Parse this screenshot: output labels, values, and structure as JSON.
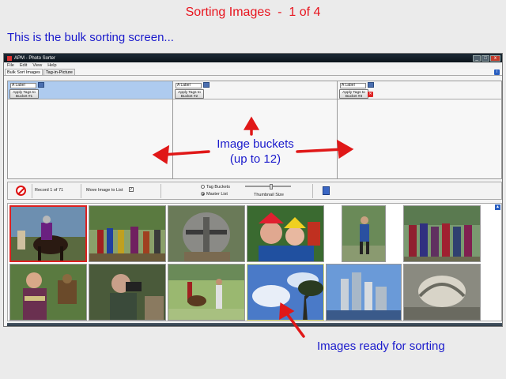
{
  "slide": {
    "title": "Sorting Images  -  1 of 4",
    "subtitle": "This is the bulk sorting screen...",
    "caption": "Images ready for sorting",
    "annotation_line1": "Image buckets",
    "annotation_line2": "(up to 12)"
  },
  "window": {
    "title": "APM - Photo Sorter",
    "min_glyph": "_",
    "max_glyph": "□",
    "close_glyph": "x"
  },
  "menu": [
    "File",
    "Edit",
    "View",
    "Help"
  ],
  "tabs": [
    "Bulk Sort Images",
    "Tag-in-Picture"
  ],
  "help_icon_glyph": "i",
  "buckets": [
    {
      "label_placeholder": "A Label",
      "apply_line1": "Apply Tags to",
      "apply_line2": "Bucket #1"
    },
    {
      "label_placeholder": "A Label",
      "apply_line1": "Apply Tags to",
      "apply_line2": "Bucket #2"
    },
    {
      "label_placeholder": "A Label",
      "apply_line1": "Apply Tags to",
      "apply_line2": "Bucket #3"
    }
  ],
  "delete_glyph": "✕",
  "controls": {
    "record_text": "Record 1 of 71",
    "move_label": "Move Image to List",
    "move_checked": true,
    "check_glyph": "✓",
    "radio_tag": "Tag Buckets",
    "radio_master": "Master List",
    "radio_selected": "Master List",
    "thumb_label": "Thumbnail Size",
    "thumb_size_level": 0.55
  },
  "scroll_glyph": "▲",
  "colors": {
    "title_red": "#e8141e",
    "annotation_blue": "#1a1acc",
    "selected_bucket": "#aecbef",
    "arrow_red": "#e01818"
  },
  "thumbnails": [
    {
      "subject": "knight on horse",
      "selected": true
    },
    {
      "subject": "jousting crowd"
    },
    {
      "subject": "helmet closeup"
    },
    {
      "subject": "jester faces"
    },
    {
      "subject": "costumed figure"
    },
    {
      "subject": "crowd parade"
    },
    {
      "subject": "woman with falcon"
    },
    {
      "subject": "man with camera"
    },
    {
      "subject": "rider in field"
    },
    {
      "subject": "sky and tree",
      "highlighted": true
    },
    {
      "subject": "city skyline"
    },
    {
      "subject": "stone carving"
    }
  ]
}
